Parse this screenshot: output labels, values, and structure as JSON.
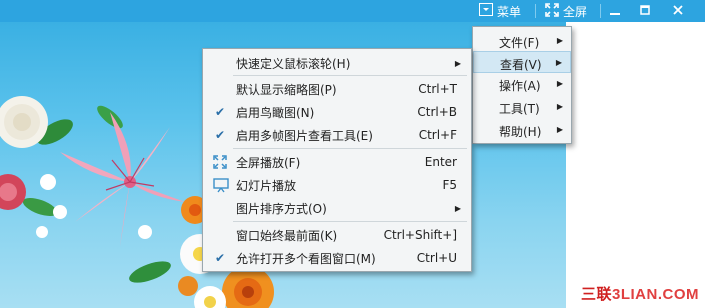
{
  "topbar": {
    "menu_label": "菜单",
    "fullscreen_label": "全屏",
    "minimize_icon": "minimize-icon",
    "restore_icon": "restore-icon",
    "close_icon": "close-icon",
    "colors": {
      "bar": "#2da4e0"
    }
  },
  "main_menu": {
    "items": [
      {
        "label": "文件(F)",
        "has_submenu": true
      },
      {
        "label": "查看(V)",
        "has_submenu": true,
        "active": true
      },
      {
        "label": "操作(A)",
        "has_submenu": true
      },
      {
        "label": "工具(T)",
        "has_submenu": true
      },
      {
        "label": "帮助(H)",
        "has_submenu": true
      }
    ]
  },
  "view_menu": {
    "items": [
      {
        "label": "快速定义鼠标滚轮(H)",
        "shortcut": "",
        "submenu": true,
        "checked": false
      },
      {
        "label": "默认显示缩略图(P)",
        "shortcut": "Ctrl+T",
        "checked": false
      },
      {
        "label": "启用鸟瞰图(N)",
        "shortcut": "Ctrl+B",
        "checked": true
      },
      {
        "label": "启用多帧图片查看工具(E)",
        "shortcut": "Ctrl+F",
        "checked": true
      },
      {
        "label": "全屏播放(F)",
        "shortcut": "Enter",
        "icon": "fullscreen-icon"
      },
      {
        "label": "幻灯片播放",
        "shortcut": "F5",
        "icon": "slideshow-icon"
      },
      {
        "label": "图片排序方式(O)",
        "shortcut": "",
        "submenu": true
      },
      {
        "label": "窗口始终最前面(K)",
        "shortcut": "Ctrl+Shift+]",
        "checked": false
      },
      {
        "label": "允许打开多个看图窗口(M)",
        "shortcut": "Ctrl+U",
        "checked": true
      }
    ]
  },
  "watermark": {
    "part1": "三联",
    "part2": "3LIAN.COM"
  }
}
